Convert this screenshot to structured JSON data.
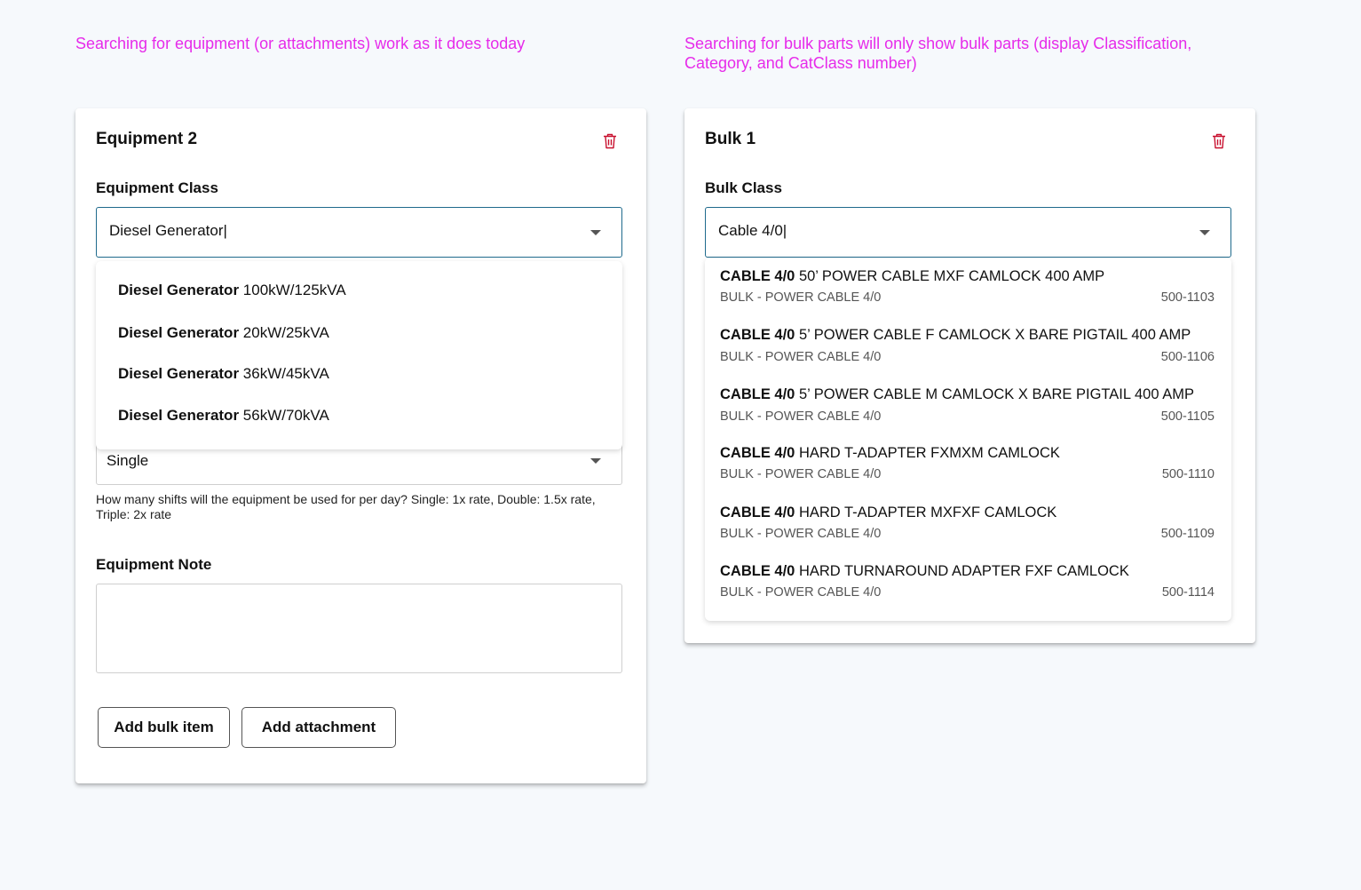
{
  "annotations": {
    "left": "Searching for equipment (or attachments) work as it does today",
    "right_line1": "Searching for bulk parts will only show bulk parts (display Classification,",
    "right_line2": "Category, and CatClass number)"
  },
  "equipment_card": {
    "title": "Equipment 2",
    "class_label": "Equipment Class",
    "class_value": "Diesel Generator|",
    "options": [
      {
        "bold": "Diesel Generator",
        "rest": " 100kW/125kVA"
      },
      {
        "bold": "Diesel Generator",
        "rest": " 20kW/25kVA"
      },
      {
        "bold": "Diesel Generator",
        "rest": " 36kW/45kVA"
      },
      {
        "bold": "Diesel Generator",
        "rest": " 56kW/70kVA"
      }
    ],
    "shift_value": "Single",
    "shift_helper": "How many shifts will the equipment be used for per day? Single: 1x rate, Double: 1.5x rate, Triple: 2x rate",
    "note_label": "Equipment Note",
    "note_value": "",
    "add_bulk_label": "Add bulk item",
    "add_attachment_label": "Add attachment"
  },
  "bulk_card": {
    "title": "Bulk 1",
    "class_label": "Bulk Class",
    "class_value": "Cable 4/0|",
    "results": [
      {
        "bold": "CABLE 4/0",
        "rest": " 50’ POWER CABLE MXF CAMLOCK 400 AMP",
        "category": "BULK - POWER CABLE 4/0",
        "code": "500-1103"
      },
      {
        "bold": "CABLE 4/0",
        "rest": " 5’ POWER CABLE F CAMLOCK X BARE PIGTAIL 400 AMP",
        "category": "BULK - POWER CABLE 4/0",
        "code": "500-1106"
      },
      {
        "bold": "CABLE 4/0",
        "rest": " 5’ POWER CABLE M CAMLOCK X BARE PIGTAIL 400 AMP",
        "category": "BULK - POWER CABLE 4/0",
        "code": "500-1105"
      },
      {
        "bold": "CABLE 4/0",
        "rest": " HARD T-ADAPTER FXMXM CAMLOCK",
        "category": "BULK - POWER CABLE 4/0",
        "code": "500-1110"
      },
      {
        "bold": "CABLE 4/0",
        "rest": " HARD T-ADAPTER MXFXF CAMLOCK",
        "category": "BULK - POWER CABLE 4/0",
        "code": "500-1109"
      },
      {
        "bold": "CABLE 4/0",
        "rest": " HARD TURNAROUND ADAPTER FXF CAMLOCK",
        "category": "BULK - POWER CABLE 4/0",
        "code": "500-1114"
      }
    ]
  },
  "colors": {
    "annotation": "#e62bea",
    "trash_icon": "#c8102e",
    "focus_border": "#1f6a8c",
    "background": "#f6f9fc"
  },
  "icons": {
    "delete": "trash-icon",
    "dropdown": "chevron-down-icon"
  }
}
